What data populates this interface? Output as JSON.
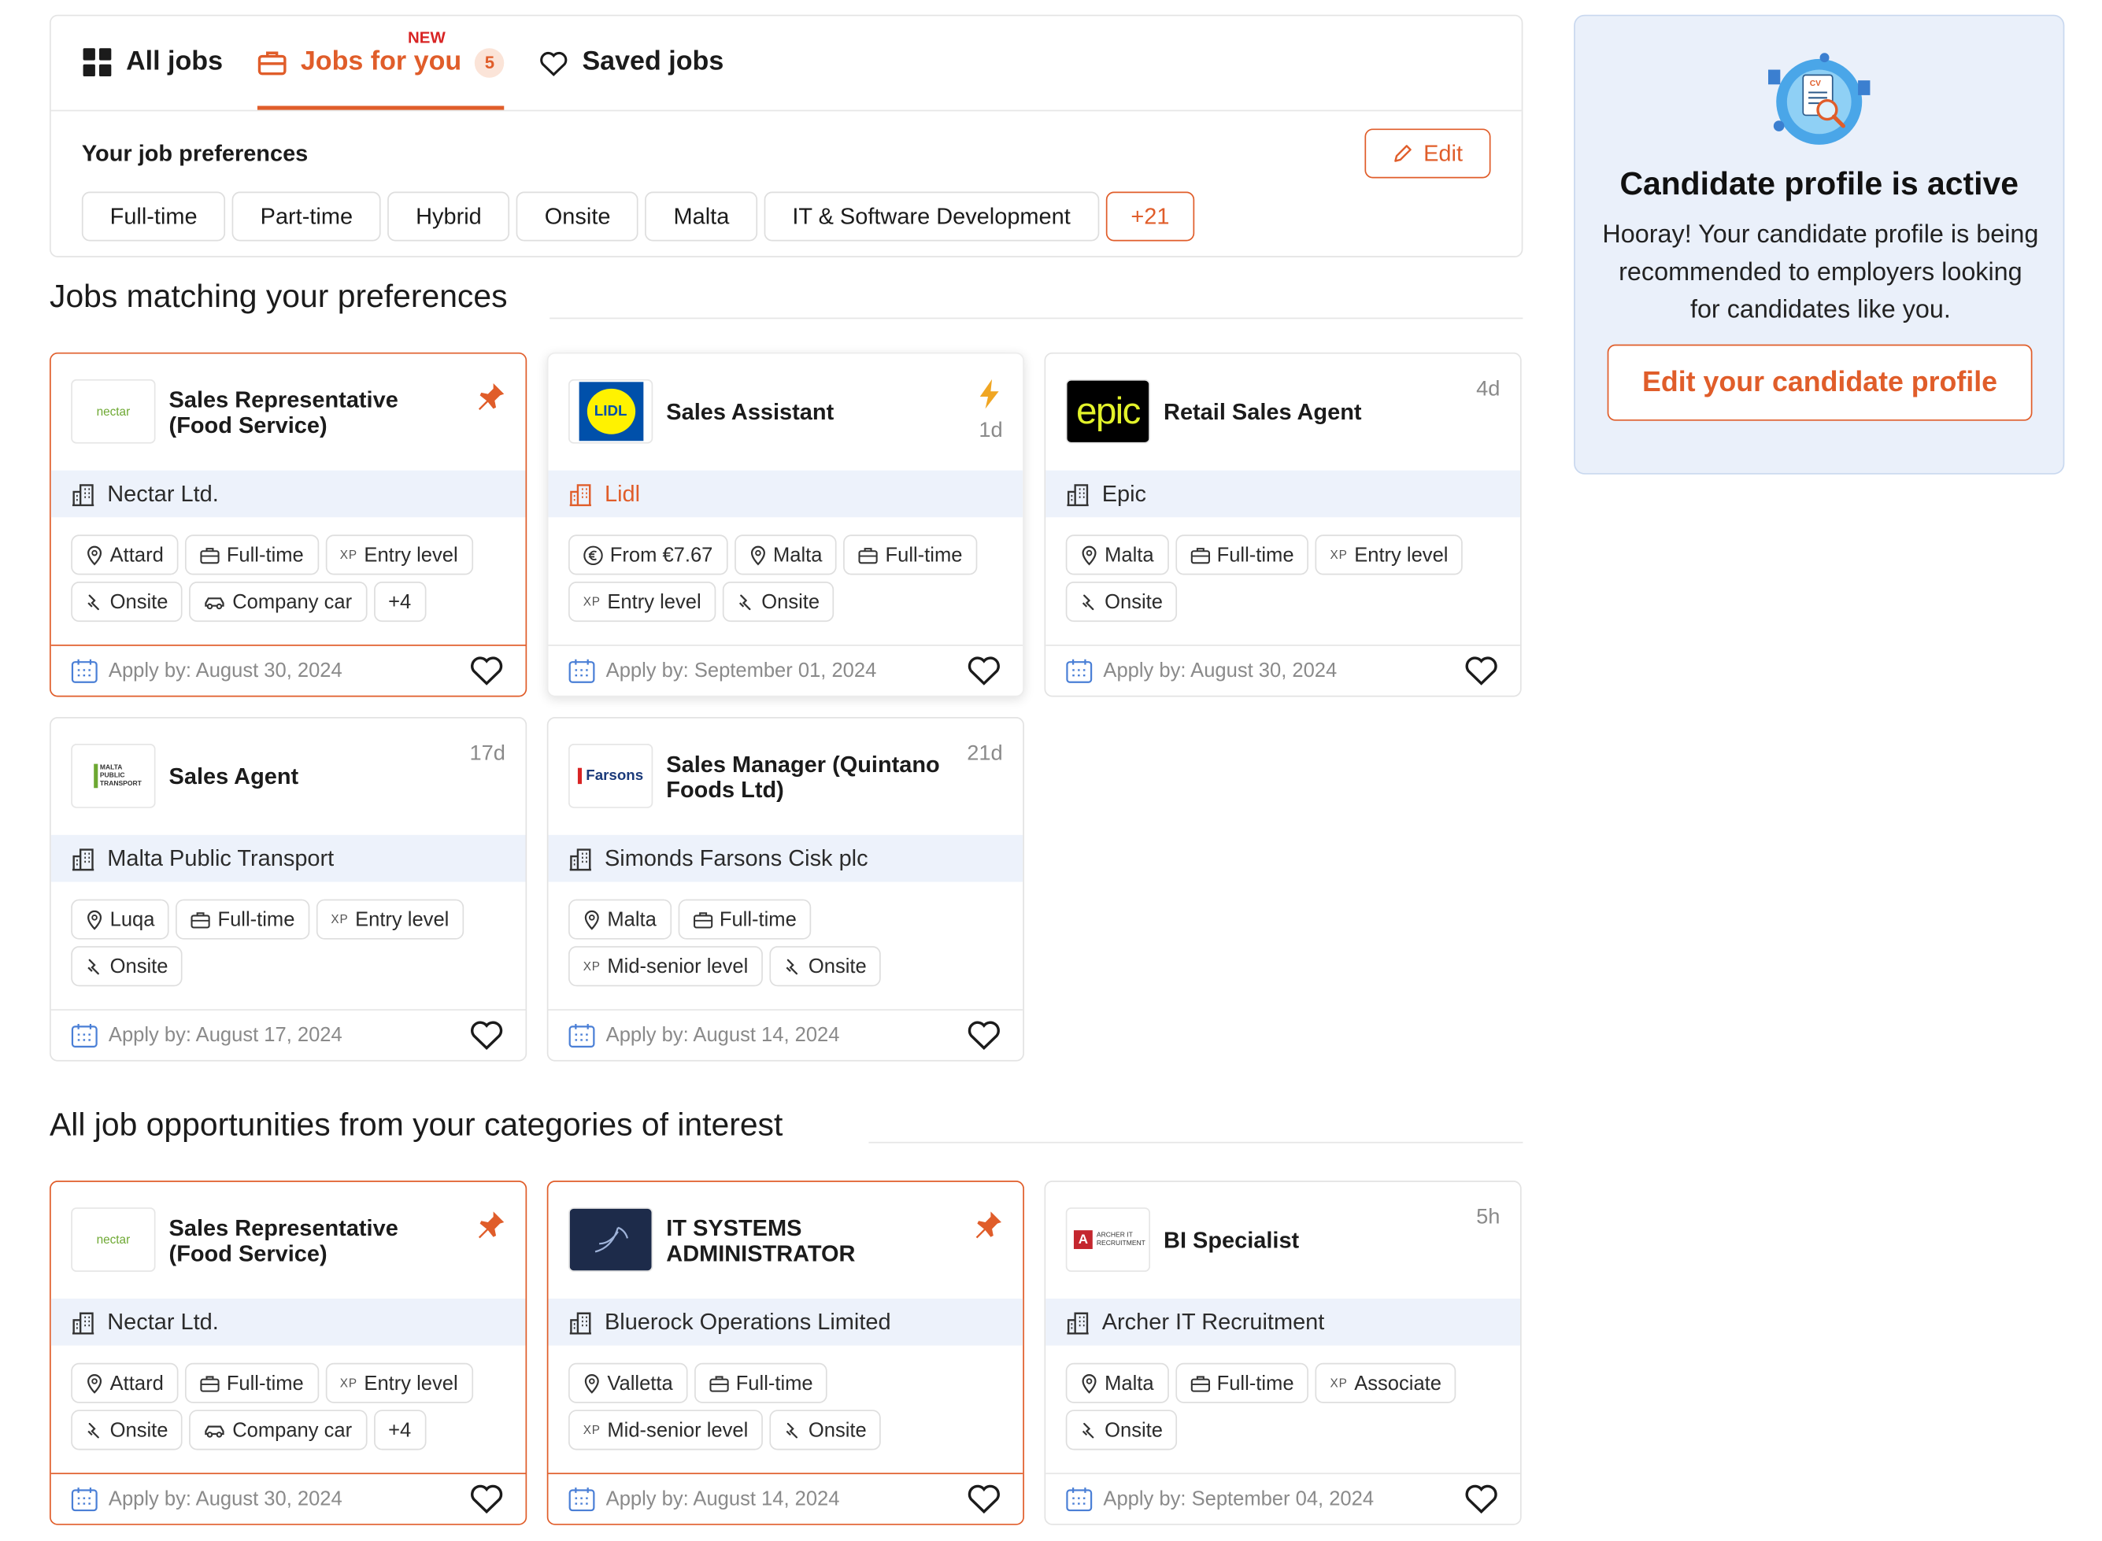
{
  "tabs": [
    {
      "label": "All jobs",
      "icon": "grid-icon"
    },
    {
      "label": "Jobs for you",
      "icon": "briefcase-icon",
      "badge_new": "NEW",
      "count": "5"
    },
    {
      "label": "Saved jobs",
      "icon": "heart-icon"
    }
  ],
  "preferences": {
    "title": "Your job preferences",
    "edit_label": "Edit",
    "chips": [
      "Full-time",
      "Part-time",
      "Hybrid",
      "Onsite",
      "Malta",
      "IT & Software Development"
    ],
    "more_label": "+21"
  },
  "sections": {
    "matching_title": "Jobs matching your preferences",
    "all_title": "All job opportunities from your categories of interest"
  },
  "matching_jobs": [
    {
      "title": "Sales Representative (Food Service)",
      "company": "Nectar Ltd.",
      "logo_text": "nectar",
      "marker": "pin",
      "tags": [
        {
          "icon": "location-icon",
          "text": "Attard"
        },
        {
          "icon": "briefcase-icon",
          "text": "Full-time"
        },
        {
          "icon": "xp",
          "text": "Entry level"
        },
        {
          "icon": "onsite-icon",
          "text": "Onsite"
        },
        {
          "icon": "car-icon",
          "text": "Company car"
        },
        {
          "icon": "",
          "text": "+4"
        }
      ],
      "apply_by": "Apply by: August 30, 2024"
    },
    {
      "title": "Sales Assistant",
      "company": "Lidl",
      "logo_text": "LIDL",
      "marker": "bolt",
      "age": "1d",
      "tags": [
        {
          "icon": "euro-icon",
          "text": "From €7.67"
        },
        {
          "icon": "location-icon",
          "text": "Malta"
        },
        {
          "icon": "briefcase-icon",
          "text": "Full-time"
        },
        {
          "icon": "xp",
          "text": "Entry level"
        },
        {
          "icon": "onsite-icon",
          "text": "Onsite"
        }
      ],
      "apply_by": "Apply by: September 01, 2024"
    },
    {
      "title": "Retail Sales Agent",
      "company": "Epic",
      "logo_text": "epic",
      "age": "4d",
      "tags": [
        {
          "icon": "location-icon",
          "text": "Malta"
        },
        {
          "icon": "briefcase-icon",
          "text": "Full-time"
        },
        {
          "icon": "xp",
          "text": "Entry level"
        },
        {
          "icon": "onsite-icon",
          "text": "Onsite"
        }
      ],
      "apply_by": "Apply by: August 30, 2024"
    },
    {
      "title": "Sales Agent",
      "company": "Malta Public Transport",
      "logo_text": "MALTA PUBLIC TRANSPORT",
      "age": "17d",
      "tags": [
        {
          "icon": "location-icon",
          "text": "Luqa"
        },
        {
          "icon": "briefcase-icon",
          "text": "Full-time"
        },
        {
          "icon": "xp",
          "text": "Entry level"
        },
        {
          "icon": "onsite-icon",
          "text": "Onsite"
        }
      ],
      "apply_by": "Apply by: August 17, 2024"
    },
    {
      "title": "Sales Manager (Quintano Foods Ltd)",
      "company": "Simonds Farsons Cisk plc",
      "logo_text": "Farsons",
      "age": "21d",
      "tags": [
        {
          "icon": "location-icon",
          "text": "Malta"
        },
        {
          "icon": "briefcase-icon",
          "text": "Full-time"
        },
        {
          "icon": "xp",
          "text": "Mid-senior level"
        },
        {
          "icon": "onsite-icon",
          "text": "Onsite"
        }
      ],
      "apply_by": "Apply by: August 14, 2024"
    }
  ],
  "all_jobs": [
    {
      "title": "Sales Representative (Food Service)",
      "company": "Nectar Ltd.",
      "logo_text": "nectar",
      "marker": "pin",
      "tags": [
        {
          "icon": "location-icon",
          "text": "Attard"
        },
        {
          "icon": "briefcase-icon",
          "text": "Full-time"
        },
        {
          "icon": "xp",
          "text": "Entry level"
        },
        {
          "icon": "onsite-icon",
          "text": "Onsite"
        },
        {
          "icon": "car-icon",
          "text": "Company car"
        },
        {
          "icon": "",
          "text": "+4"
        }
      ],
      "apply_by": "Apply by: August 30, 2024"
    },
    {
      "title": "IT SYSTEMS ADMINISTRATOR",
      "company": "Bluerock Operations Limited",
      "logo_text": "",
      "marker": "pin",
      "tags": [
        {
          "icon": "location-icon",
          "text": "Valletta"
        },
        {
          "icon": "briefcase-icon",
          "text": "Full-time"
        },
        {
          "icon": "xp",
          "text": "Mid-senior level"
        },
        {
          "icon": "onsite-icon",
          "text": "Onsite"
        }
      ],
      "apply_by": "Apply by: August 14, 2024"
    },
    {
      "title": "BI Specialist",
      "company": "Archer IT Recruitment",
      "logo_text": "ARCHER IT RECRUITMENT",
      "age": "5h",
      "tags": [
        {
          "icon": "location-icon",
          "text": "Malta"
        },
        {
          "icon": "briefcase-icon",
          "text": "Full-time"
        },
        {
          "icon": "xp",
          "text": "Associate"
        },
        {
          "icon": "onsite-icon",
          "text": "Onsite"
        }
      ],
      "apply_by": "Apply by: September 04, 2024"
    }
  ],
  "profile": {
    "title": "Candidate profile is active",
    "text": "Hooray! Your candidate profile is being recommended to employers looking for candidates like you.",
    "illustration_label": "CV",
    "button_label": "Edit your candidate profile"
  },
  "colors": {
    "accent": "#e05d2a",
    "company_band": "#edf2fb",
    "profile_bg": "#eaf0fa",
    "new_badge": "#d82424"
  }
}
